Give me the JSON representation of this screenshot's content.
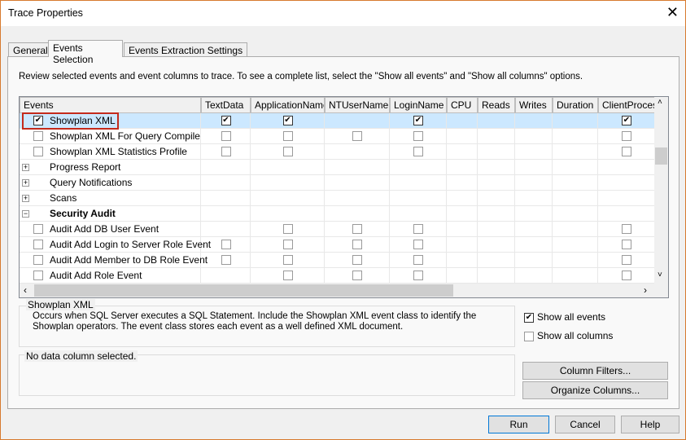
{
  "window": {
    "title": "Trace Properties"
  },
  "tabs": [
    {
      "label": "General"
    },
    {
      "label": "Events Selection"
    },
    {
      "label": "Events Extraction Settings"
    }
  ],
  "description": "Review selected events and event columns to trace. To see a complete list, select the \"Show all events\" and \"Show all columns\" options.",
  "grid": {
    "columns": [
      "Events",
      "TextData",
      "ApplicationName",
      "NTUserName",
      "LoginName",
      "CPU",
      "Reads",
      "Writes",
      "Duration",
      "ClientProcess"
    ],
    "rows": [
      {
        "label": "Showplan XML",
        "type": "event",
        "checked": true,
        "selected": true,
        "cells": [
          "c",
          "c",
          "",
          "c",
          "",
          "",
          "",
          "",
          "c"
        ]
      },
      {
        "label": "Showplan XML For Query Compile",
        "type": "event",
        "checked": false,
        "cells": [
          "u",
          "u",
          "u",
          "u",
          "",
          "",
          "",
          "",
          "u"
        ]
      },
      {
        "label": "Showplan XML Statistics Profile",
        "type": "event",
        "checked": false,
        "cells": [
          "u",
          "u",
          "",
          "u",
          "",
          "",
          "",
          "",
          "u"
        ]
      },
      {
        "label": "Progress Report",
        "type": "category",
        "expanded": false,
        "cells": []
      },
      {
        "label": "Query Notifications",
        "type": "category",
        "expanded": false,
        "cells": []
      },
      {
        "label": "Scans",
        "type": "category",
        "expanded": false,
        "cells": []
      },
      {
        "label": "Security Audit",
        "type": "category",
        "expanded": true,
        "bold": true,
        "cells": []
      },
      {
        "label": "Audit Add DB User Event",
        "type": "event",
        "checked": false,
        "cells": [
          "",
          "u",
          "u",
          "u",
          "",
          "",
          "",
          "",
          "u"
        ]
      },
      {
        "label": "Audit Add Login to Server Role Event",
        "type": "event",
        "checked": false,
        "cells": [
          "u",
          "u",
          "u",
          "u",
          "",
          "",
          "",
          "",
          "u"
        ]
      },
      {
        "label": "Audit Add Member to DB Role Event",
        "type": "event",
        "checked": false,
        "cells": [
          "u",
          "u",
          "u",
          "u",
          "",
          "",
          "",
          "",
          "u"
        ]
      },
      {
        "label": "Audit Add Role Event",
        "type": "event",
        "checked": false,
        "cells": [
          "",
          "u",
          "u",
          "u",
          "",
          "",
          "",
          "",
          "u"
        ]
      }
    ]
  },
  "event_info": {
    "title": "Showplan XML",
    "text": "Occurs when SQL Server executes a SQL Statement. Include the Showplan XML event class to identify the Showplan operators. The event class stores each event as a well defined XML document."
  },
  "column_info": {
    "title": "No data column selected."
  },
  "options": {
    "show_all_events": {
      "label": "Show all events",
      "checked": true
    },
    "show_all_columns": {
      "label": "Show all columns",
      "checked": false
    }
  },
  "buttons": {
    "column_filters": "Column Filters...",
    "organize_columns": "Organize Columns...",
    "run": "Run",
    "cancel": "Cancel",
    "help": "Help"
  },
  "colors": {
    "selected_row": "#cce8ff",
    "highlight_border": "#c42b1c"
  }
}
